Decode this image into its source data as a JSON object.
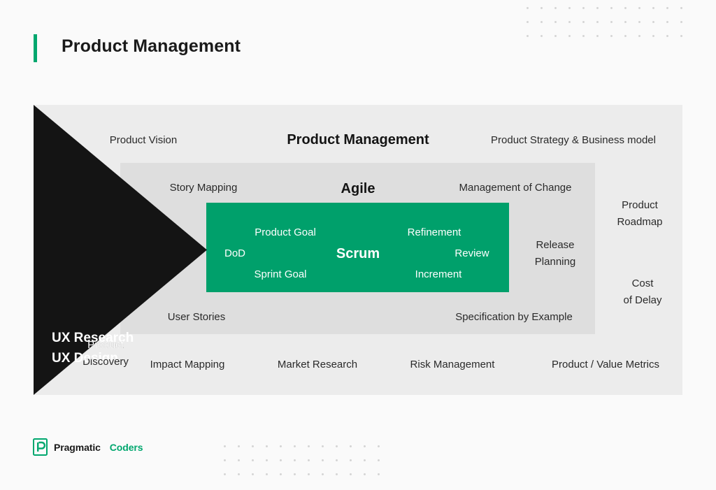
{
  "header": {
    "title": "Product Management",
    "accent_color": "#00A76E"
  },
  "colors": {
    "page_background": "#FAFAFA",
    "outer_box": "#ECECEC",
    "middle_box": "#DEDEDE",
    "inner_box": "#00A06B",
    "arrow": "#141414",
    "dot": "#D5D5D5",
    "text_dark": "#2A2A2A",
    "text_light": "#FFFFFF"
  },
  "diagram": {
    "arrow": {
      "line1": "UX Research",
      "line2": "UX Design"
    },
    "outer": {
      "heading": "Product Management",
      "labels": {
        "product_vision": "Product Vision",
        "product_strategy": "Product Strategy & Business model",
        "product_roadmap_line1": "Product",
        "product_roadmap_line2": "Roadmap",
        "cost_of_delay_line1": "Cost",
        "cost_of_delay_line2": "of Delay",
        "product_discovery_line1": "Product",
        "product_discovery_line2": "Discovery",
        "impact_mapping": "Impact Mapping",
        "market_research": "Market Research",
        "risk_management": "Risk Management",
        "product_value_metrics": "Product / Value Metrics"
      }
    },
    "middle": {
      "heading": "Agile",
      "labels": {
        "story_mapping": "Story Mapping",
        "management_of_change": "Management of Change",
        "release_planning_line1": "Release",
        "release_planning_line2": "Planning",
        "user_stories": "User Stories",
        "specification_by_example": "Specification by Example"
      }
    },
    "inner": {
      "heading": "Scrum",
      "labels": {
        "product_goal": "Product Goal",
        "dod": "DoD",
        "sprint_goal": "Sprint Goal",
        "refinement": "Refinement",
        "review": "Review",
        "increment": "Increment"
      }
    }
  },
  "dot_grids": {
    "top": {
      "columns": 12,
      "rows": 3
    },
    "bottom": {
      "columns": 12,
      "rows": 3
    }
  },
  "logo": {
    "mark": "pragmatic-coders-p-mark",
    "word_one": "Pragmatic",
    "word_two": "Coders"
  }
}
